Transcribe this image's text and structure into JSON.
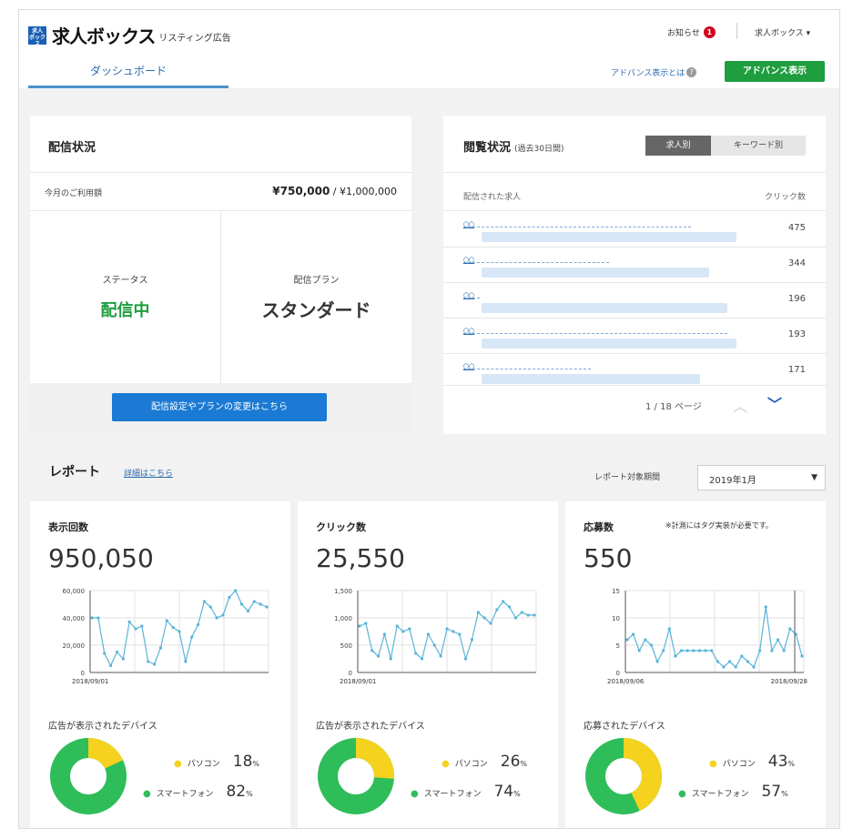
{
  "header": {
    "logo_mark": "求人ボックス",
    "logo_name": "求人ボックス",
    "logo_sub": "リスティング広告",
    "notice_label": "お知らせ",
    "notice_count": "1",
    "account_label": "求人ボックス ▾",
    "tab_dashboard": "ダッシュボード",
    "advance_link": "アドバンス表示とは",
    "advance_button": "アドバンス表示"
  },
  "distribution": {
    "title": "配信状況",
    "usage_label": "今月のご利用額",
    "usage_current": "¥750,000",
    "usage_limit": " / ¥1,000,000",
    "status_label": "ステータス",
    "status_value": "配信中",
    "plan_label": "配信プラン",
    "plan_value": "スタンダード",
    "change_button": "配信設定やプランの変更はこちら"
  },
  "views": {
    "title": "閲覧状況",
    "subtitle": "(過去30日間)",
    "toggle_job": "求人別",
    "toggle_keyword": "キーワード別",
    "col_job": "配信された求人",
    "col_clicks": "クリック数",
    "rows": [
      {
        "link": "〇〇",
        "clicks": "475"
      },
      {
        "link": "〇〇",
        "clicks": "344"
      },
      {
        "link": "〇〇",
        "clicks": "196"
      },
      {
        "link": "〇〇",
        "clicks": "193"
      },
      {
        "link": "〇〇",
        "clicks": "171"
      }
    ],
    "pager": "1 / 18 ページ"
  },
  "report": {
    "title": "レポート",
    "detail_link": "詳細はこちら",
    "period_label": "レポート対象期間",
    "period_value": "2019年1月"
  },
  "cards": [
    {
      "title": "表示回数",
      "note": "",
      "value": "950,050",
      "device_label": "広告が表示されたデバイス",
      "pc_label": "パソコン",
      "pc_pct": "18",
      "sp_label": "スマートフォン",
      "sp_pct": "82",
      "unit": "%"
    },
    {
      "title": "クリック数",
      "note": "",
      "value": "25,550",
      "device_label": "広告が表示されたデバイス",
      "pc_label": "パソコン",
      "pc_pct": "26",
      "sp_label": "スマートフォン",
      "sp_pct": "74",
      "unit": "%"
    },
    {
      "title": "応募数",
      "note": "※計測にはタグ実装が必要です。",
      "value": "550",
      "device_label": "応募されたデバイス",
      "pc_label": "パソコン",
      "pc_pct": "43",
      "sp_label": "スマートフォン",
      "sp_pct": "57",
      "unit": "%"
    }
  ],
  "chart_data": [
    {
      "type": "line",
      "ylim": [
        0,
        60000
      ],
      "yticks": [
        "60,000",
        "40,000",
        "20,000",
        "0"
      ],
      "x_start_label": "2018/09/01",
      "x_end_label": "",
      "values": [
        40000,
        40000,
        14000,
        5000,
        15000,
        10000,
        37000,
        32000,
        34000,
        8000,
        6000,
        18000,
        38000,
        33000,
        30000,
        8000,
        26000,
        35000,
        52000,
        48000,
        40000,
        42000,
        55000,
        60000,
        50000,
        45000,
        52000,
        50000,
        48000
      ]
    },
    {
      "type": "line",
      "ylim": [
        0,
        1500
      ],
      "yticks": [
        "1,500",
        "1,000",
        "500",
        "0"
      ],
      "x_start_label": "2018/09/01",
      "x_end_label": "",
      "values": [
        850,
        900,
        400,
        300,
        700,
        250,
        850,
        750,
        800,
        350,
        250,
        700,
        500,
        300,
        800,
        750,
        700,
        250,
        600,
        1100,
        1000,
        900,
        1150,
        1300,
        1200,
        1000,
        1100,
        1050,
        1050
      ]
    },
    {
      "type": "line",
      "ylim": [
        0,
        15
      ],
      "yticks": [
        "15",
        "10",
        "5",
        "0"
      ],
      "x_start_label": "2018/09/06",
      "x_end_label": "2018/09/28",
      "values": [
        6,
        7,
        4,
        6,
        5,
        2,
        4,
        8,
        3,
        4,
        4,
        4,
        4,
        4,
        4,
        2,
        1,
        2,
        1,
        3,
        2,
        1,
        4,
        12,
        4,
        6,
        4,
        8,
        7,
        3
      ]
    }
  ],
  "colors": {
    "pc": "#f5d21e",
    "sp": "#2ebd59",
    "line": "#5ab4d9"
  }
}
